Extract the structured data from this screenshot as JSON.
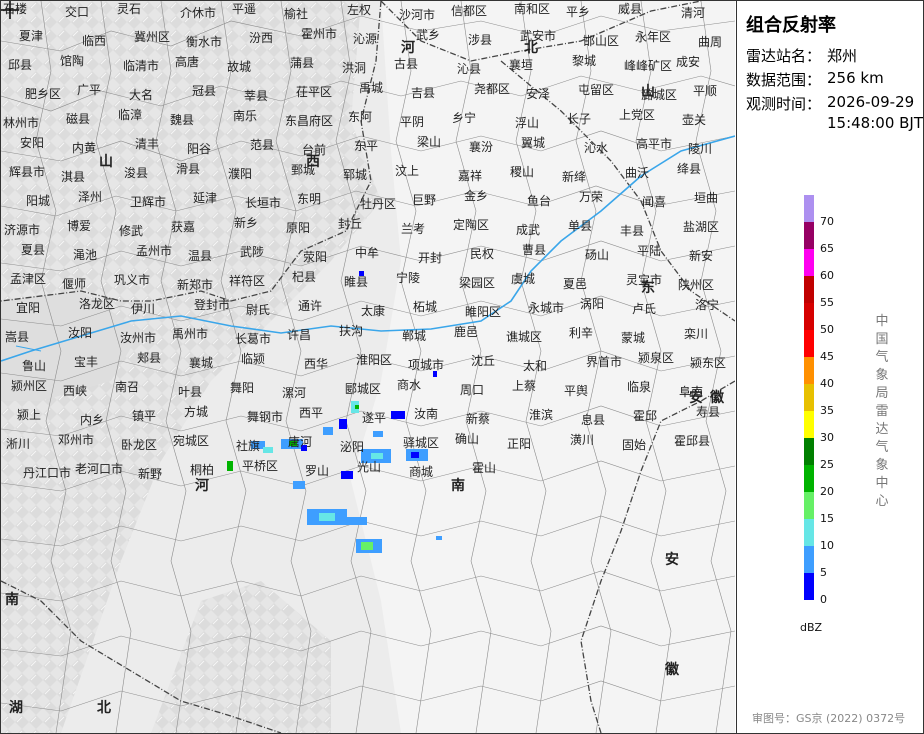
{
  "product": {
    "title": "组合反射率",
    "station_label": "雷达站名：",
    "station_value": "郑州",
    "range_label": "数据范围：",
    "range_value": "256 km",
    "time_label": "观测时间：",
    "time_value_date": "2026-09-29",
    "time_value_clock": "15:48:00 BJT"
  },
  "legend": {
    "unit": "dBZ",
    "levels": [
      {
        "value": "70",
        "color": "#ad90f0"
      },
      {
        "value": "65",
        "color": "#960064"
      },
      {
        "value": "60",
        "color": "#ff00f0"
      },
      {
        "value": "55",
        "color": "#c00000"
      },
      {
        "value": "50",
        "color": "#d60000"
      },
      {
        "value": "45",
        "color": "#ff0000"
      },
      {
        "value": "40",
        "color": "#ff9000"
      },
      {
        "value": "35",
        "color": "#e7c000"
      },
      {
        "value": "30",
        "color": "#ffff00"
      },
      {
        "value": "25",
        "color": "#008000"
      },
      {
        "value": "20",
        "color": "#00b300"
      },
      {
        "value": "15",
        "color": "#66f066"
      },
      {
        "value": "10",
        "color": "#66e6e6"
      },
      {
        "value": "5",
        "color": "#3e9eff"
      },
      {
        "value": "0",
        "color": "#0000ff"
      }
    ]
  },
  "agency": "中国气象局雷达气象中心",
  "approval": "审图号：GS京 (2022) 0372号",
  "provinces": [
    {
      "name": "山",
      "id": "shanxi-1"
    },
    {
      "name": "西",
      "id": "shanxi-2"
    },
    {
      "name": "河",
      "id": "hebei-1"
    },
    {
      "name": "北",
      "id": "hebei-2"
    },
    {
      "name": "山",
      "id": "shandong-1"
    },
    {
      "name": "东",
      "id": "shandong-2"
    },
    {
      "name": "安",
      "id": "anhui-1"
    },
    {
      "name": "徽",
      "id": "anhui-2"
    },
    {
      "name": "安",
      "id": "anhui-3"
    },
    {
      "name": "徽",
      "id": "anhui-4"
    },
    {
      "name": "河",
      "id": "henan-1"
    },
    {
      "name": "南",
      "id": "henan-2"
    },
    {
      "name": "湖",
      "id": "hubei-1"
    },
    {
      "name": "北",
      "id": "hubei-2"
    },
    {
      "name": "南",
      "id": "hunan-1"
    }
  ],
  "cities": [
    "石楼",
    "交口",
    "灵石",
    "介休市",
    "平遥",
    "榆社",
    "左权",
    "沙河市",
    "信都区",
    "南和区",
    "平乡",
    "威县",
    "清河",
    "夏津",
    "临西",
    "冀州区",
    "衡水市",
    "汾西",
    "霍州市",
    "沁源",
    "武乡",
    "涉县",
    "武安市",
    "邯山区",
    "永年区",
    "曲周",
    "邱县",
    "馆陶",
    "临清市",
    "高唐",
    "故城",
    "蒲县",
    "洪洞",
    "古县",
    "沁县",
    "襄垣",
    "黎城",
    "峰峰矿区",
    "成安",
    "肥乡区",
    "广平",
    "大名",
    "冠县",
    "莘县",
    "茌平区",
    "禹城",
    "吉县",
    "尧都区",
    "安泽",
    "屯留区",
    "潞城区",
    "平顺",
    "林州市",
    "磁县",
    "临漳",
    "魏县",
    "南乐",
    "东昌府区",
    "东阿",
    "平阴",
    "乡宁",
    "浮山",
    "长子",
    "上党区",
    "壶关",
    "安阳",
    "内黄",
    "清丰",
    "阳谷",
    "范县",
    "台前",
    "东平",
    "梁山",
    "襄汾",
    "翼城",
    "沁水",
    "高平市",
    "陵川",
    "辉县市",
    "淇县",
    "浚县",
    "滑县",
    "濮阳",
    "鄄城",
    "郓城",
    "汶上",
    "嘉祥",
    "稷山",
    "新绛",
    "曲沃",
    "绛县",
    "阳城",
    "泽州",
    "卫辉市",
    "延津",
    "长垣市",
    "东明",
    "牡丹区",
    "巨野",
    "金乡",
    "鱼台",
    "万荣",
    "闻喜",
    "垣曲",
    "济源市",
    "博爱",
    "修武",
    "获嘉",
    "新乡",
    "原阳",
    "封丘",
    "兰考",
    "定陶区",
    "成武",
    "单县",
    "丰县",
    "盐湖区",
    "夏县",
    "渑池",
    "孟州市",
    "温县",
    "武陟",
    "荥阳",
    "中牟",
    "开封",
    "民权",
    "曹县",
    "砀山",
    "平陆",
    "新安",
    "孟津区",
    "偃师",
    "巩义市",
    "新郑市",
    "祥符区",
    "杞县",
    "睢县",
    "宁陵",
    "梁园区",
    "虞城",
    "夏邑",
    "灵宝市",
    "陕州区",
    "宜阳",
    "洛龙区",
    "伊川",
    "登封市",
    "尉氏",
    "通许",
    "太康",
    "柘城",
    "睢阳区",
    "永城市",
    "涡阳",
    "卢氏",
    "洛宁",
    "嵩县",
    "汝阳",
    "汝州市",
    "禹州市",
    "长葛市",
    "许昌",
    "扶沟",
    "郸城",
    "鹿邑",
    "谯城区",
    "利辛",
    "蒙城",
    "栾川",
    "鲁山",
    "宝丰",
    "郏县",
    "襄城",
    "临颍",
    "西华",
    "淮阳区",
    "项城市",
    "沈丘",
    "太和",
    "界首市",
    "颍泉区",
    "颍东区",
    "颍州区",
    "西峡",
    "南召",
    "叶县",
    "舞阳",
    "漯河",
    "郾城区",
    "商水",
    "周口",
    "上蔡",
    "平舆",
    "临泉",
    "阜南",
    "颍上",
    "内乡",
    "镇平",
    "方城",
    "舞钢市",
    "西平",
    "遂平",
    "汝南",
    "新蔡",
    "淮滨",
    "息县",
    "霍邱",
    "寿县",
    "淅川",
    "邓州市",
    "卧龙区",
    "宛城区",
    "社旗",
    "唐河",
    "泌阳",
    "驿城区",
    "确山",
    "正阳",
    "潢川",
    "固始",
    "霍邱县",
    "丹江口市",
    "老河口市",
    "新野",
    "桐柏",
    "平桥区",
    "罗山",
    "光山",
    "商城",
    "霍山"
  ],
  "map_marker": "radar-center-cross"
}
